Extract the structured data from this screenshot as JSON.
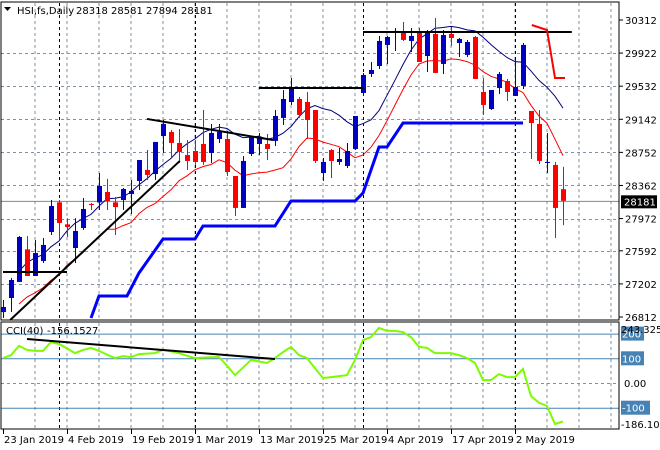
{
  "header": {
    "symbol": "HSI,fs,Daily",
    "ohlc": "28318 28581 27894 28181",
    "menu_icon": "triangle-down-icon"
  },
  "chart_data": [
    {
      "type": "candlestick",
      "title": "HSI,fs,Daily",
      "price_axis": {
        "ticks": [
          "30312",
          "29922",
          "29532",
          "29142",
          "28752",
          "28362",
          "27972",
          "27592",
          "27202",
          "26812"
        ],
        "range": [
          26812,
          30312
        ],
        "current_price_label": "28181",
        "current_price": 28181
      },
      "date_axis": {
        "labels": [
          "23 Jan 2019",
          "4 Feb 2019",
          "19 Feb 2019",
          "1 Mar 2019",
          "13 Mar 2019",
          "25 Mar 2019",
          "4 Apr 2019",
          "17 Apr 2019",
          "2 May 2019"
        ],
        "label_bar_index": [
          0,
          8,
          16,
          24,
          32,
          40,
          48,
          56,
          64
        ]
      },
      "period_separators_bar_index": [
        7,
        24,
        45,
        64
      ],
      "colors": {
        "bull": "#0000c0",
        "bear": "#ff0000",
        "upper_ma": "#000080",
        "lower_ma": "#ff0000",
        "stop_line": "#0000ff",
        "trendline": "#000000"
      },
      "candles": [
        [
          26870,
          27013,
          26800,
          26930
        ],
        [
          27036,
          27272,
          26871,
          27248
        ],
        [
          27225,
          27767,
          27225,
          27755
        ],
        [
          27609,
          27767,
          27295,
          27295
        ],
        [
          27295,
          27720,
          27295,
          27566
        ],
        [
          27472,
          27743,
          27449,
          27661
        ],
        [
          27814,
          28191,
          27779,
          28120
        ],
        [
          28163,
          28191,
          27720,
          27920
        ],
        [
          27904,
          27975,
          27755,
          27873
        ],
        [
          27625,
          27975,
          27449,
          27826
        ],
        [
          27861,
          28215,
          27838,
          28085
        ],
        [
          28144,
          28156,
          28073,
          28132
        ],
        [
          28163,
          28509,
          28073,
          28356
        ],
        [
          28285,
          28439,
          28073,
          28179
        ],
        [
          28163,
          28226,
          27779,
          28108
        ],
        [
          28191,
          28332,
          28073,
          28320
        ],
        [
          28262,
          28427,
          28026,
          28297
        ],
        [
          28415,
          28662,
          28309,
          28662
        ],
        [
          28545,
          28780,
          28427,
          28486
        ],
        [
          28497,
          28875,
          28427,
          28875
        ],
        [
          28945,
          29134,
          28745,
          29087
        ],
        [
          28992,
          29016,
          28698,
          28863
        ],
        [
          28863,
          29028,
          28627,
          28757
        ],
        [
          28721,
          28898,
          28545,
          28651
        ],
        [
          28768,
          28898,
          28604,
          28639
        ],
        [
          28851,
          29252,
          28604,
          28639
        ],
        [
          28745,
          29087,
          28627,
          28981
        ],
        [
          28910,
          29087,
          28863,
          28992
        ],
        [
          28910,
          29004,
          28474,
          28521
        ],
        [
          28474,
          28474,
          28002,
          28097
        ],
        [
          28097,
          28710,
          28097,
          28651
        ],
        [
          28733,
          28945,
          28710,
          28934
        ],
        [
          28851,
          28981,
          28721,
          28934
        ],
        [
          28851,
          28969,
          28662,
          28792
        ],
        [
          28887,
          29252,
          28827,
          29181
        ],
        [
          29158,
          29487,
          29075,
          29381
        ],
        [
          29346,
          29629,
          29311,
          29511
        ],
        [
          29381,
          29405,
          29158,
          29193
        ],
        [
          29346,
          29464,
          28910,
          29134
        ],
        [
          29252,
          29252,
          28627,
          28651
        ],
        [
          28509,
          28686,
          28415,
          28639
        ],
        [
          28780,
          28792,
          28450,
          28651
        ],
        [
          28639,
          28804,
          28604,
          28674
        ],
        [
          28592,
          28863,
          28568,
          28768
        ],
        [
          28792,
          29181,
          28780,
          29181
        ],
        [
          29452,
          29688,
          29417,
          29664
        ],
        [
          29676,
          29817,
          29641,
          29723
        ],
        [
          29770,
          30124,
          29735,
          30065
        ],
        [
          30018,
          30124,
          29794,
          30112
        ],
        [
          30159,
          30218,
          29947,
          30183
        ],
        [
          30171,
          30289,
          30065,
          30077
        ],
        [
          30065,
          30218,
          29935,
          30124
        ],
        [
          30159,
          30218,
          29817,
          29817
        ],
        [
          29888,
          30194,
          29699,
          30159
        ],
        [
          30147,
          30336,
          29688,
          29688
        ],
        [
          29794,
          30194,
          29676,
          30135
        ],
        [
          30147,
          30230,
          30006,
          30100
        ],
        [
          30041,
          30100,
          29876,
          30088
        ],
        [
          29900,
          30077,
          29876,
          30053
        ],
        [
          30112,
          30124,
          29617,
          29617
        ],
        [
          29464,
          29629,
          29193,
          29311
        ],
        [
          29263,
          29487,
          29252,
          29487
        ],
        [
          29511,
          29699,
          29440,
          29676
        ],
        [
          29593,
          29617,
          29358,
          29464
        ],
        [
          29417,
          29841,
          29417,
          29523
        ],
        [
          29535,
          30041,
          29499,
          30018
        ],
        [
          29240,
          29240,
          28674,
          29098
        ],
        [
          29087,
          29252,
          28615,
          28651
        ],
        [
          28627,
          28981,
          28509,
          28639
        ],
        [
          28604,
          28639,
          27743,
          28097
        ],
        [
          28318,
          28581,
          27894,
          28181
        ]
      ],
      "indicators": {
        "upper_ma": {
          "source": "high",
          "period": 8
        },
        "lower_ma": {
          "source": "low",
          "period": 8
        },
        "stop_line": [
          [
            11,
            26800
          ],
          [
            12,
            27060
          ],
          [
            15.5,
            27060
          ],
          [
            17,
            27331
          ],
          [
            20,
            27731
          ],
          [
            24,
            27731
          ],
          [
            25,
            27885
          ],
          [
            34,
            27885
          ],
          [
            36,
            28179
          ],
          [
            44,
            28179
          ],
          [
            45,
            28273
          ],
          [
            47,
            28816
          ],
          [
            48,
            28816
          ],
          [
            50,
            29098
          ],
          [
            65,
            29098
          ]
        ]
      },
      "drawings": [
        {
          "name": "support-line-jan",
          "color": "#000000",
          "points": [
            [
              0,
              27342
            ],
            [
              8,
              27342
            ]
          ]
        },
        {
          "name": "rising-trendline",
          "color": "#000000",
          "points": [
            [
              0.9,
              26777
            ],
            [
              22.1,
              28651
            ]
          ]
        },
        {
          "name": "falling-trendline-feb",
          "color": "#000000",
          "points": [
            [
              18,
              29146
            ],
            [
              33.75,
              28898
            ]
          ]
        },
        {
          "name": "resistance-line-mar",
          "color": "#000000",
          "points": [
            [
              32,
              29511
            ],
            [
              45,
              29511
            ]
          ]
        },
        {
          "name": "resistance-line-apr",
          "color": "#000000",
          "points": [
            [
              45,
              30171
            ],
            [
              71.1,
              30171
            ]
          ]
        },
        {
          "name": "projection-line",
          "color": "#ff0000",
          "points": [
            [
              66.1,
              30253
            ],
            [
              68,
              30194
            ],
            [
              69,
              29629
            ],
            [
              70.25,
              29629
            ]
          ]
        }
      ]
    },
    {
      "type": "line",
      "title": "CCI(40)",
      "value_label": "-156.1527",
      "axis": {
        "max_label": "243.3258",
        "min_label": "-186.103",
        "zero_label": "0.00",
        "levels": [
          "200",
          "100",
          "-100"
        ],
        "range": [
          -186.103,
          243.3258
        ]
      },
      "color": "#7cfc00",
      "values": [
        101,
        113,
        150,
        134,
        130,
        130,
        166,
        158,
        140,
        121,
        134,
        142,
        130,
        115,
        101,
        109,
        105,
        117,
        119,
        121,
        134,
        128,
        121,
        110,
        101,
        103,
        105,
        105,
        70,
        32,
        62,
        93,
        87,
        81,
        101,
        125,
        146,
        113,
        101,
        60,
        20,
        24,
        28,
        32,
        93,
        174,
        186,
        223,
        211,
        211,
        206,
        186,
        146,
        142,
        121,
        121,
        121,
        113,
        101,
        81,
        12,
        12,
        36,
        24,
        24,
        57,
        -53,
        -80,
        -93,
        -166,
        -156
      ],
      "trendline": [
        [
          3,
          178
        ],
        [
          34,
          97
        ]
      ]
    }
  ]
}
